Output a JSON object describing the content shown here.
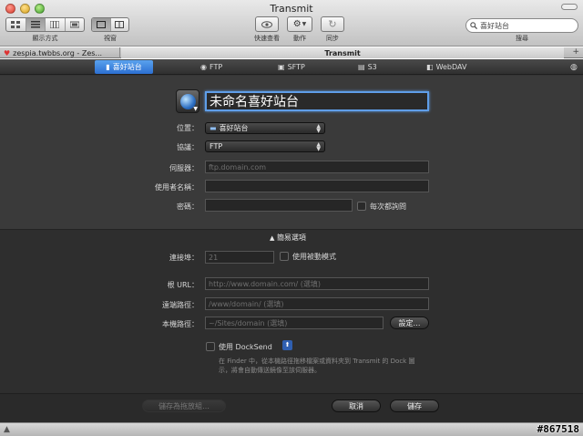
{
  "window": {
    "title": "Transmit"
  },
  "toolbar": {
    "view_mode_label": "顯示方式",
    "window_label": "視窗",
    "quicklook_label": "快速查看",
    "action_label": "動作",
    "sync_label": "同步",
    "search_label": "搜尋",
    "search_placeholder": "喜好站台"
  },
  "tabs": [
    {
      "label": "zespia.twbbs.org - Zes..."
    },
    {
      "label": "Transmit"
    }
  ],
  "protocol_tabs": [
    {
      "label": "喜好站台",
      "icon": "bookmark-icon"
    },
    {
      "label": "FTP",
      "icon": "ftp-icon"
    },
    {
      "label": "SFTP",
      "icon": "lock-icon"
    },
    {
      "label": "S3",
      "icon": "s3-icon"
    },
    {
      "label": "WebDAV",
      "icon": "webdav-icon"
    }
  ],
  "form": {
    "site_name": "未命名喜好站台",
    "location_label": "位置：",
    "location_value": "喜好站台",
    "protocol_label": "協議：",
    "protocol_value": "FTP",
    "server_label": "伺服器：",
    "server_placeholder": "ftp.domain.com",
    "username_label": "使用者名稱：",
    "username_value": "",
    "password_label": "密碼：",
    "password_value": "",
    "always_ask_label": "每次都詢問"
  },
  "advanced": {
    "toggle_label": "簡易選項",
    "port_label": "連接埠：",
    "port_placeholder": "21",
    "passive_label": "使用被動模式",
    "root_url_label": "根 URL：",
    "root_url_placeholder": "http://www.domain.com/ (選填)",
    "remote_path_label": "遠端路徑：",
    "remote_path_placeholder": "/www/domain/ (選填)",
    "local_path_label": "本機路徑：",
    "local_path_placeholder": "~/Sites/domain (選填)",
    "settings_button": "設定…",
    "docksend_label": "使用 DockSend",
    "docksend_help_1": "在 Finder 中，從本機路徑拖移檔案或資料夾到 Transmit 的 Dock 圖",
    "docksend_help_2": "示，將會自動傳送鏡像至該伺服器。"
  },
  "footer": {
    "save_as_droplet": "儲存為拖放組…",
    "cancel": "取消",
    "save": "儲存"
  },
  "watermark": "#867518"
}
